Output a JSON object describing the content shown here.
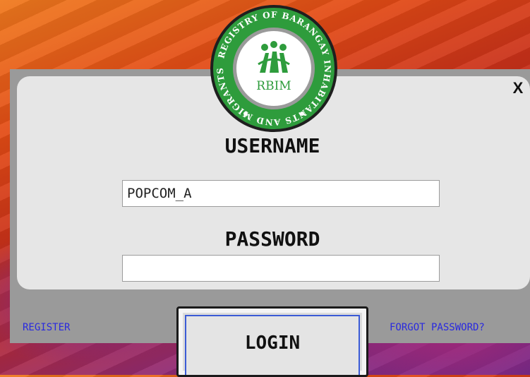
{
  "window": {
    "close_label": "X"
  },
  "logo": {
    "ring_text": "REGISTRY OF BARANGAY INHABITANTS AND MIGRANTS",
    "center_text": "RBIM"
  },
  "form": {
    "username_label": "USERNAME",
    "username_value": "POPCOM_A",
    "password_label": "PASSWORD",
    "password_value": ""
  },
  "links": {
    "register": "REGISTER",
    "forgot": "FORGOT PASSWORD?"
  },
  "buttons": {
    "login": "LOGIN"
  },
  "colors": {
    "logo_green": "#2e9c3c",
    "link_blue": "#2a2adf",
    "panel_gray": "#e6e6e6"
  }
}
